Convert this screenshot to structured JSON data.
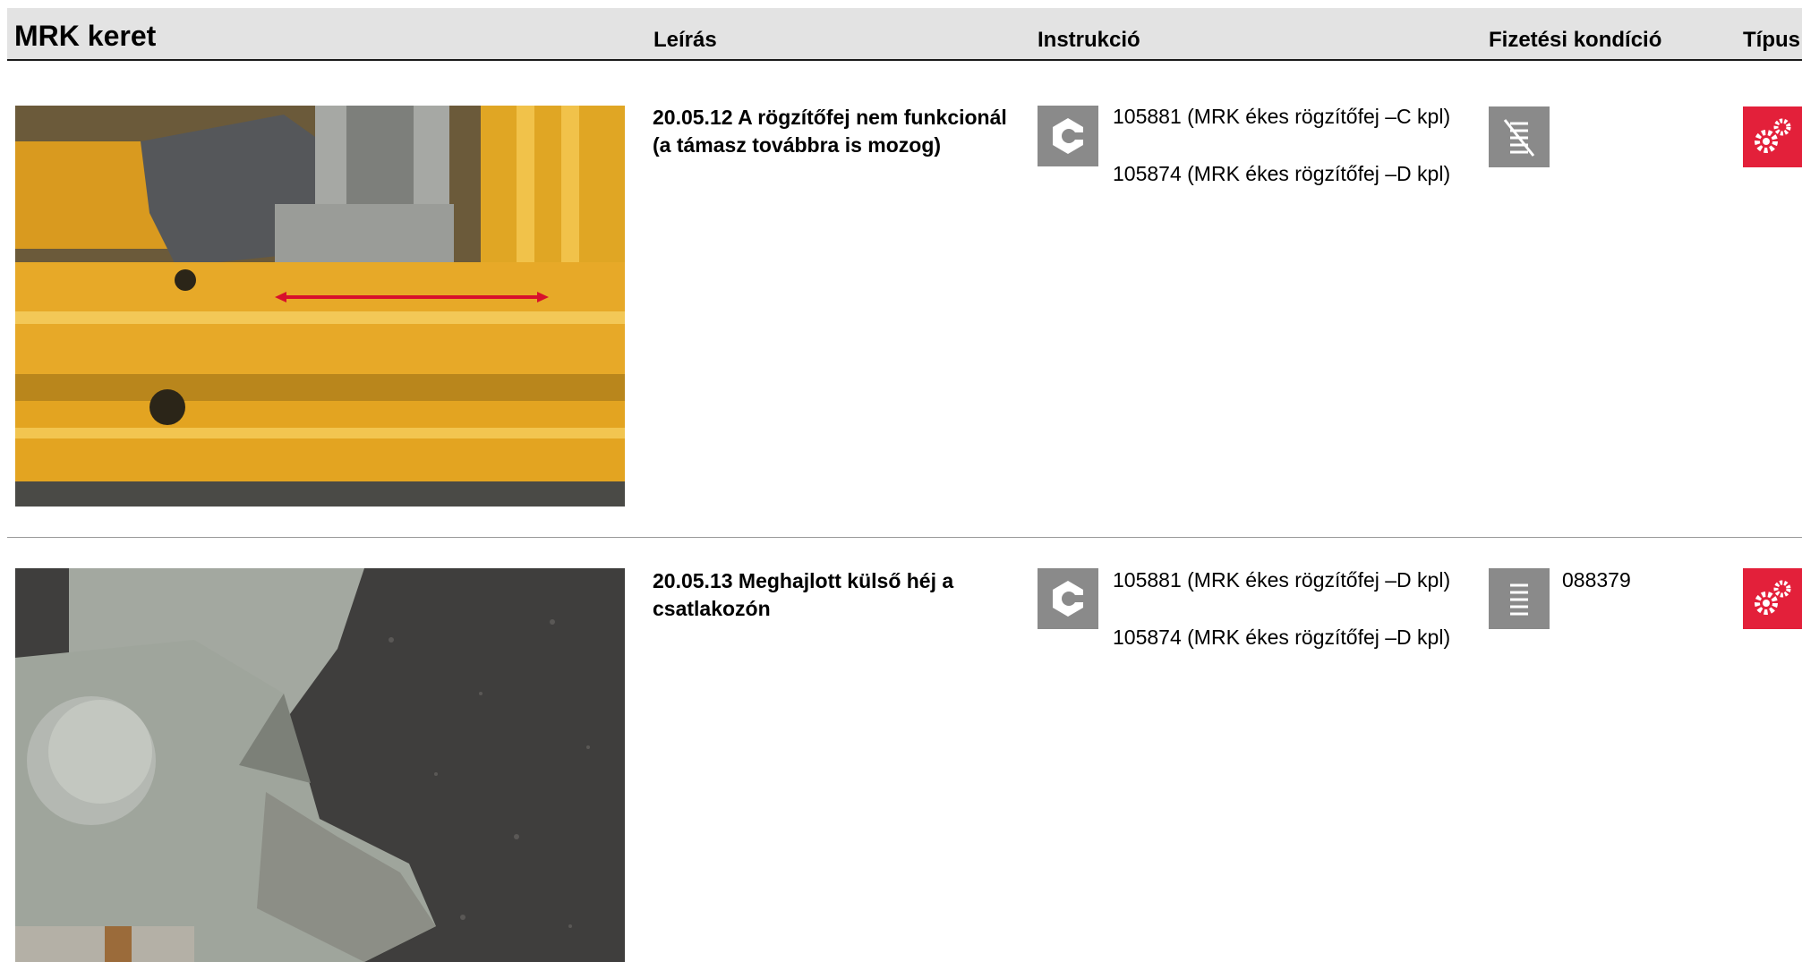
{
  "header": {
    "title": "MRK keret",
    "col_description": "Leírás",
    "col_instruction": "Instrukció",
    "col_payment": "Fizetési kondíció",
    "col_type": "Típus"
  },
  "rows": [
    {
      "description": "20.05.12 A rögzítőfej nem funkcionál (a támasz továbbra is mozog)",
      "parts": [
        "105881 (MRK ékes rögzítőfej –C kpl)",
        "105874 (MRK ékes rögzítőfej –D kpl)"
      ],
      "instruction_icon": "hex-nut-icon",
      "payment_icon": "coin-stack-crossed-icon",
      "payment_code": "",
      "type_icon": "gears-icon"
    },
    {
      "description": "20.05.13 Meghajlott külső héj a csatlakozón",
      "parts": [
        "105881 (MRK ékes rögzítőfej –D kpl)",
        "105874 (MRK ékes rögzítőfej –D kpl)"
      ],
      "instruction_icon": "hex-nut-icon",
      "payment_icon": "coin-stack-icon",
      "payment_code": "088379",
      "type_icon": "gears-icon"
    }
  ],
  "colors": {
    "header_bg": "#e3e3e3",
    "icon_gray": "#8a8a8a",
    "type_red": "#e3203a",
    "arrow_red": "#d8102c"
  }
}
